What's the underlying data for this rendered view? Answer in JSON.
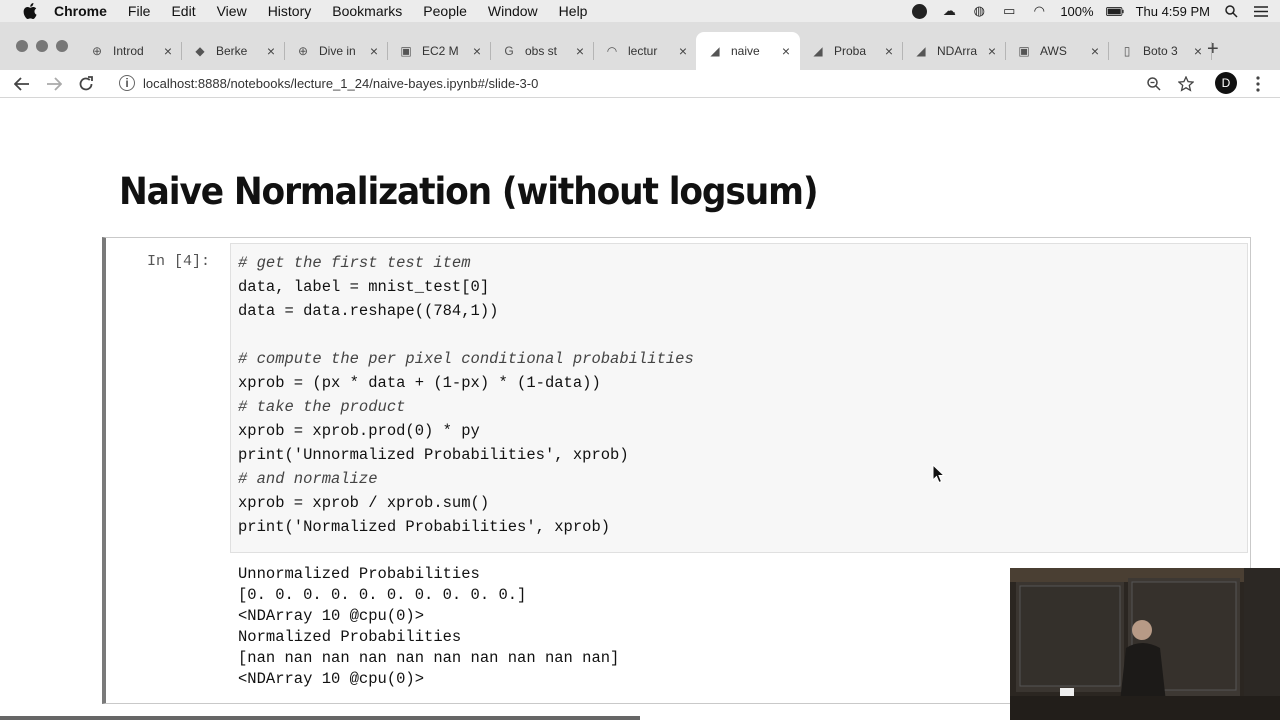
{
  "menubar": {
    "app_name": "Chrome",
    "items": [
      "File",
      "Edit",
      "View",
      "History",
      "Bookmarks",
      "People",
      "Window",
      "Help"
    ],
    "battery": "100%",
    "clock": "Thu 4:59 PM"
  },
  "tabs": [
    {
      "title": "Introd",
      "favicon": "globe-icon",
      "active": false
    },
    {
      "title": "Berke",
      "favicon": "berkeley-icon",
      "active": false
    },
    {
      "title": "Dive in",
      "favicon": "globe-icon",
      "active": false
    },
    {
      "title": "EC2 M",
      "favicon": "aws-icon",
      "active": false
    },
    {
      "title": "obs st",
      "favicon": "google-icon",
      "active": false
    },
    {
      "title": "lectur",
      "favicon": "loading-icon",
      "active": false
    },
    {
      "title": "naive",
      "favicon": "jupyter-icon",
      "active": true
    },
    {
      "title": "Proba",
      "favicon": "jupyter-icon",
      "active": false
    },
    {
      "title": "NDArra",
      "favicon": "jupyter-icon",
      "active": false
    },
    {
      "title": "AWS",
      "favicon": "aws-icon",
      "active": false
    },
    {
      "title": "Boto 3",
      "favicon": "document-icon",
      "active": false
    }
  ],
  "toolbar": {
    "url": "localhost:8888/notebooks/lecture_1_24/naive-bayes.ipynb#/slide-3-0",
    "avatar_letter": "D"
  },
  "notebook": {
    "slide_title": "Naive Normalization (without logsum)",
    "cell_prompt": "In [4]:",
    "code_lines": [
      {
        "text": "# get the first test item",
        "comment": true
      },
      {
        "text": "data, label = mnist_test[0]",
        "comment": false
      },
      {
        "text": "data = data.reshape((784,1))",
        "comment": false
      },
      {
        "text": "",
        "comment": false
      },
      {
        "text": "# compute the per pixel conditional probabilities",
        "comment": true
      },
      {
        "text": "xprob = (px * data + (1-px) * (1-data))",
        "comment": false
      },
      {
        "text": "# take the product",
        "comment": true
      },
      {
        "text": "xprob = xprob.prod(0) * py",
        "comment": false
      },
      {
        "text": "print('Unnormalized Probabilities', xprob)",
        "comment": false
      },
      {
        "text": "# and normalize",
        "comment": true
      },
      {
        "text": "xprob = xprob / xprob.sum()",
        "comment": false
      },
      {
        "text": "print('Normalized Probabilities', xprob)",
        "comment": false
      }
    ],
    "output_lines": [
      "Unnormalized Probabilities",
      "[0. 0. 0. 0. 0. 0. 0. 0. 0. 0.]",
      "<NDArray 10 @cpu(0)>",
      "Normalized Probabilities",
      "[nan nan nan nan nan nan nan nan nan nan]",
      "<NDArray 10 @cpu(0)>"
    ]
  }
}
